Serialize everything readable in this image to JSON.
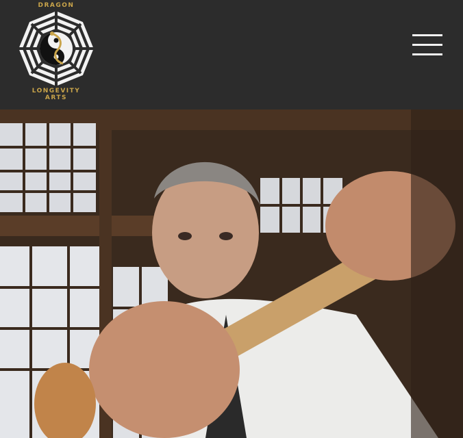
{
  "header": {
    "logo": {
      "line_top": "DRAGON",
      "line_bottom_1": "LONGEVITY",
      "line_bottom_2": "ARTS",
      "icon": "yin-yang-bagua-icon",
      "accent_color": "#c9a44a"
    },
    "menu_icon": "hamburger-menu-icon"
  },
  "hero": {
    "image": "photo of martial arts master holding a wooden staff in a traditional dojo"
  }
}
